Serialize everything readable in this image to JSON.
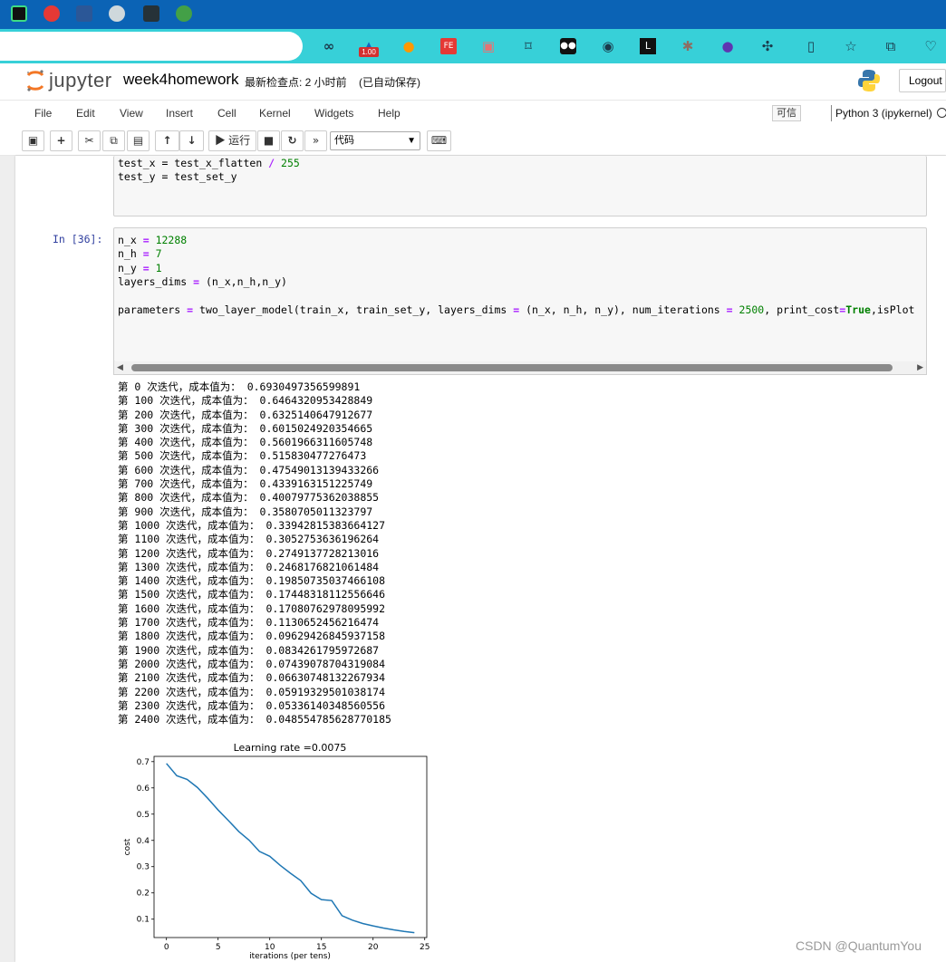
{
  "browser": {
    "extension_badge": "1.00"
  },
  "jupyter": {
    "logo_text": "jupyter",
    "notebook_title": "week4homework",
    "checkpoint": "最新检查点: 2 小时前",
    "autosave": "(已自动保存)",
    "logout_label": "Logout"
  },
  "menu": {
    "items": [
      "File",
      "Edit",
      "View",
      "Insert",
      "Cell",
      "Kernel",
      "Widgets",
      "Help"
    ],
    "trusted": "可信",
    "kernel": "Python 3 (ipykernel)"
  },
  "toolbar": {
    "run_label": "▶ 运行",
    "cell_type": "代码"
  },
  "cells": {
    "prev": {
      "line1": "test_x = test_x_flatten / 255",
      "line2": "test_y = test_set_y"
    },
    "current": {
      "prompt": "In  [36]:",
      "lines": [
        "n_x = 12288",
        "n_h = 7",
        "n_y = 1",
        "layers_dims = (n_x,n_h,n_y)",
        "",
        "parameters = two_layer_model(train_x, train_set_y, layers_dims = (n_x, n_h, n_y), num_iterations = 2500, print_cost=True,isPlot"
      ]
    }
  },
  "output_lines": [
    "第 0 次迭代，成本值为： 0.6930497356599891",
    "第 100 次迭代，成本值为： 0.6464320953428849",
    "第 200 次迭代，成本值为： 0.6325140647912677",
    "第 300 次迭代，成本值为： 0.6015024920354665",
    "第 400 次迭代，成本值为： 0.5601966311605748",
    "第 500 次迭代，成本值为： 0.515830477276473",
    "第 600 次迭代，成本值为： 0.47549013139433266",
    "第 700 次迭代，成本值为： 0.4339163151225749",
    "第 800 次迭代，成本值为： 0.40079775362038855",
    "第 900 次迭代，成本值为： 0.3580705011323797",
    "第 1000 次迭代，成本值为： 0.33942815383664127",
    "第 1100 次迭代，成本值为： 0.3052753636196264",
    "第 1200 次迭代，成本值为： 0.2749137728213016",
    "第 1300 次迭代，成本值为： 0.2468176821061484",
    "第 1400 次迭代，成本值为： 0.19850735037466108",
    "第 1500 次迭代，成本值为： 0.17448318112556646",
    "第 1600 次迭代，成本值为： 0.17080762978095992",
    "第 1700 次迭代，成本值为： 0.1130652456216474",
    "第 1800 次迭代，成本值为： 0.09629426845937158",
    "第 1900 次迭代，成本值为： 0.0834261795972687",
    "第 2000 次迭代，成本值为： 0.07439078704319084",
    "第 2100 次迭代，成本值为： 0.06630748132267934",
    "第 2200 次迭代，成本值为： 0.05919329501038174",
    "第 2300 次迭代，成本值为： 0.05336140348560556",
    "第 2400 次迭代，成本值为： 0.048554785628770185"
  ],
  "chart_data": {
    "type": "line",
    "title": "Learning rate =0.0075",
    "xlabel": "iterations (per tens)",
    "ylabel": "cost",
    "xlim": [
      -1.2,
      25.2
    ],
    "ylim": [
      0.03,
      0.72
    ],
    "xticks": [
      0,
      5,
      10,
      15,
      20,
      25
    ],
    "yticks": [
      0.1,
      0.2,
      0.3,
      0.4,
      0.5,
      0.6,
      0.7
    ],
    "ytick_labels": [
      "0.1",
      "0.2",
      "0.3",
      "0.4",
      "0.5",
      "0.6",
      "0.7"
    ],
    "color": "#1f77b4",
    "x": [
      0,
      1,
      2,
      3,
      4,
      5,
      6,
      7,
      8,
      9,
      10,
      11,
      12,
      13,
      14,
      15,
      16,
      17,
      18,
      19,
      20,
      21,
      22,
      23,
      24
    ],
    "y": [
      0.6930497356599891,
      0.6464320953428849,
      0.6325140647912677,
      0.6015024920354665,
      0.5601966311605748,
      0.515830477276473,
      0.47549013139433266,
      0.4339163151225749,
      0.40079775362038855,
      0.3580705011323797,
      0.33942815383664127,
      0.3052753636196264,
      0.2749137728213016,
      0.2468176821061484,
      0.19850735037466108,
      0.17448318112556646,
      0.17080762978095992,
      0.1130652456216474,
      0.09629426845937158,
      0.0834261795972687,
      0.07439078704319084,
      0.06630748132267934,
      0.05919329501038174,
      0.05336140348560556,
      0.048554785628770185
    ]
  },
  "watermark": "CSDN @QuantumYou"
}
